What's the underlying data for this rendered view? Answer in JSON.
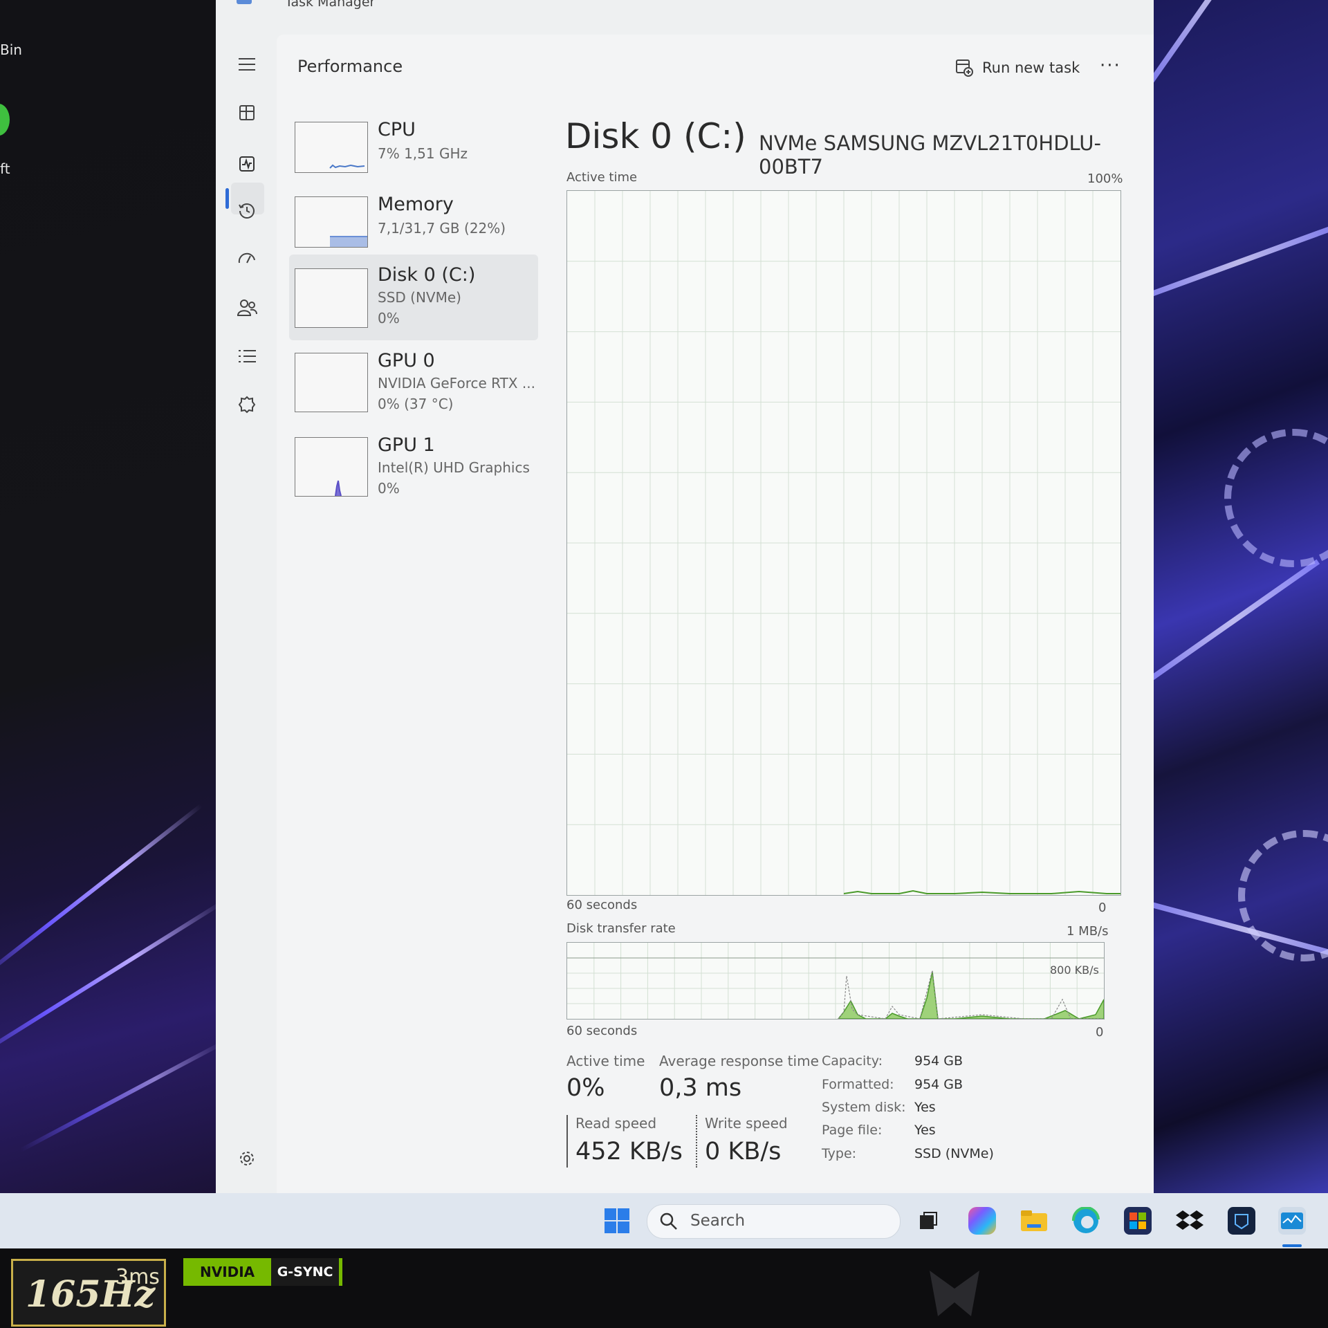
{
  "desktop": {
    "label1": "Bin",
    "label2": "ft"
  },
  "window": {
    "title": "Task Manager"
  },
  "header": {
    "title": "Performance",
    "run_task_label": "Run new task",
    "more_label": "···"
  },
  "sidebar": {
    "items": [
      {
        "name": "CPU",
        "line1": "7%  1,51 GHz",
        "line2": ""
      },
      {
        "name": "Memory",
        "line1": "7,1/31,7 GB (22%)",
        "line2": ""
      },
      {
        "name": "Disk 0 (C:)",
        "line1": "SSD (NVMe)",
        "line2": "0%"
      },
      {
        "name": "GPU 0",
        "line1": "NVIDIA GeForce RTX ...",
        "line2": "0%  (37 °C)"
      },
      {
        "name": "GPU 1",
        "line1": "Intel(R) UHD Graphics",
        "line2": "0%"
      }
    ]
  },
  "disk": {
    "title": "Disk 0 (C:)",
    "model": "NVMe SAMSUNG MZVL21T0HDLU-00BT7",
    "active_graph": {
      "label": "Active time",
      "max": "100%",
      "x_left": "60 seconds",
      "x_right": "0"
    },
    "transfer_graph": {
      "label": "Disk transfer rate",
      "max": "1 MB/s",
      "mid": "800 KB/s",
      "x_left": "60 seconds",
      "x_right": "0"
    },
    "stats": {
      "active_time_label": "Active time",
      "active_time_value": "0%",
      "response_label": "Average response time",
      "response_value": "0,3 ms",
      "read_label": "Read speed",
      "read_value": "452 KB/s",
      "write_label": "Write speed",
      "write_value": "0 KB/s"
    },
    "props": [
      {
        "k": "Capacity:",
        "v": "954 GB"
      },
      {
        "k": "Formatted:",
        "v": "954 GB"
      },
      {
        "k": "System disk:",
        "v": "Yes"
      },
      {
        "k": "Page file:",
        "v": "Yes"
      },
      {
        "k": "Type:",
        "v": "SSD (NVMe)"
      }
    ]
  },
  "taskbar": {
    "search_placeholder": "Search"
  },
  "monitor": {
    "hz": "165Hz",
    "ms": "3ms",
    "nvidia": "NVIDIA",
    "gsync": "G-SYNC"
  },
  "colors": {
    "accent": "#2e6bd6",
    "disk_graph": "#7cc24a",
    "graph_line": "#4a9a2a"
  }
}
